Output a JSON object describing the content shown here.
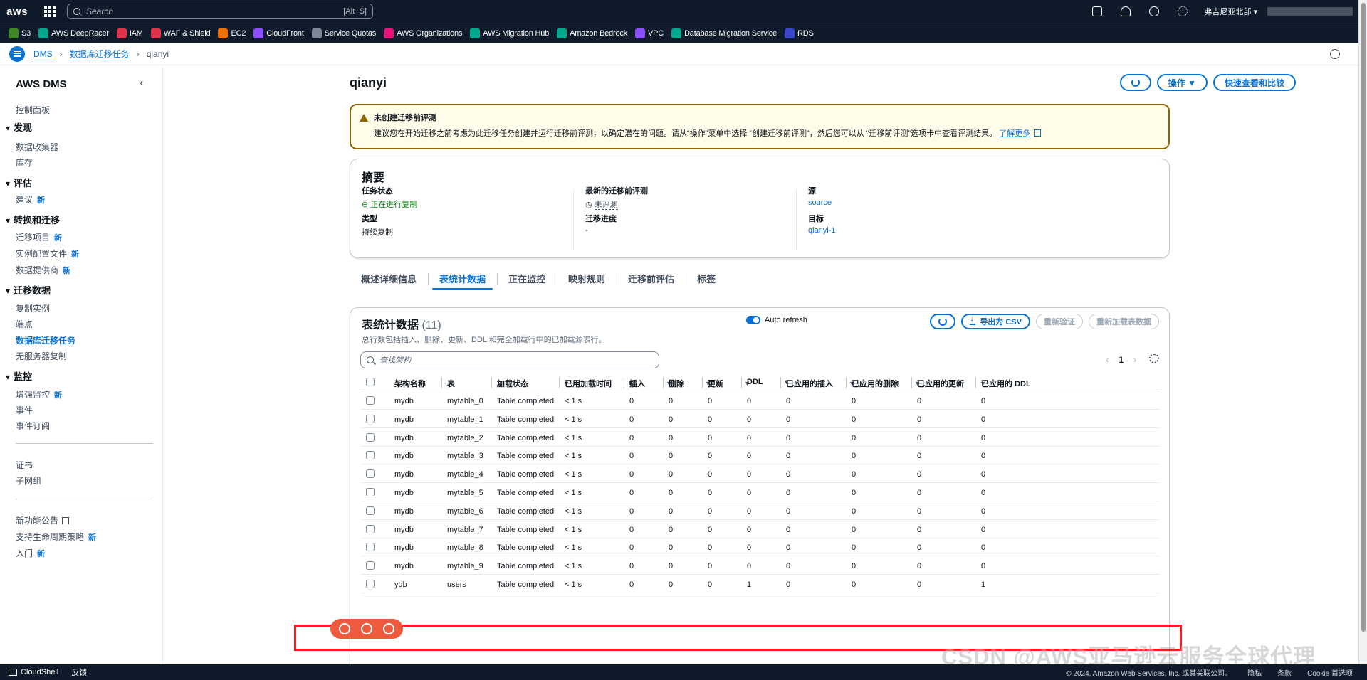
{
  "topnav": {
    "logo": "aws",
    "search_placeholder": "Search",
    "search_shortcut": "[Alt+S]",
    "region": "弗吉尼亚北部 ▾"
  },
  "favorites": [
    {
      "label": "S3",
      "color": "#3f8624"
    },
    {
      "label": "AWS DeepRacer",
      "color": "#01a88d"
    },
    {
      "label": "IAM",
      "color": "#dd344c"
    },
    {
      "label": "WAF & Shield",
      "color": "#dd344c"
    },
    {
      "label": "EC2",
      "color": "#ed7100"
    },
    {
      "label": "CloudFront",
      "color": "#8c4fff"
    },
    {
      "label": "Service Quotas",
      "color": "#7d8998"
    },
    {
      "label": "AWS Organizations",
      "color": "#e7157b"
    },
    {
      "label": "AWS Migration Hub",
      "color": "#01a88d"
    },
    {
      "label": "Amazon Bedrock",
      "color": "#01a88d"
    },
    {
      "label": "VPC",
      "color": "#8c4fff"
    },
    {
      "label": "Database Migration Service",
      "color": "#01a88d"
    },
    {
      "label": "RDS",
      "color": "#3b48cc"
    }
  ],
  "breadcrumb": {
    "root": "DMS",
    "parent": "数据库迁移任务",
    "current": "qianyi"
  },
  "sidebar": {
    "title": "AWS DMS",
    "dashboard": "控制面板",
    "sec_discover": "发现",
    "data_collectors": "数据收集器",
    "inventory": "库存",
    "sec_assess": "评估",
    "recommendations": "建议",
    "sec_convert": "转换和迁移",
    "migration_projects": "迁移项目",
    "instance_profiles": "实例配置文件",
    "data_providers": "数据提供商",
    "sec_migrate": "迁移数据",
    "replication_instances": "复制实例",
    "endpoints": "端点",
    "db_migration_tasks": "数据库迁移任务",
    "serverless": "无服务器复制",
    "sec_monitor": "监控",
    "enhanced_monitoring": "增强监控",
    "events": "事件",
    "event_subscriptions": "事件订阅",
    "certificates": "证书",
    "subnet_groups": "子网组",
    "whats_new": "新功能公告",
    "lifecycle": "支持生命周期策略",
    "getting_started": "入门",
    "new_badge": "新"
  },
  "page": {
    "title": "qianyi",
    "actions_label": "操作 ▼",
    "compare_label": "快速查看和比较"
  },
  "alert": {
    "title": "未创建迁移前评测",
    "body": "建议您在开始迁移之前考虑为此迁移任务创建并运行迁移前评测，以确定潜在的问题。请从“操作”菜单中选择 “创建迁移前评测”，然后您可以从 “迁移前评测”选项卡中查看评测结果。",
    "link": "了解更多"
  },
  "summary": {
    "heading": "摘要",
    "status_label": "任务状态",
    "status_value": "正在进行复制",
    "type_label": "类型",
    "type_value": "持续复制",
    "latest_assessment_label": "最新的迁移前评测",
    "latest_assessment_value": "未评测",
    "progress_label": "迁移进度",
    "progress_value": "-",
    "source_label": "源",
    "source_value": "source",
    "target_label": "目标",
    "target_value": "qianyi-1"
  },
  "tabs": [
    "概述详细信息",
    "表统计数据",
    "正在监控",
    "映射规则",
    "迁移前评估",
    "标签"
  ],
  "table_stats": {
    "title": "表统计数据",
    "count": "(11)",
    "description": "总行数包括插入、删除、更新、DDL 和完全加载行中的已加载源表行。",
    "auto_refresh": "Auto refresh",
    "export_csv": "导出为 CSV",
    "revalidate": "重新验证",
    "reload": "重新加载表数据",
    "filter_placeholder": "查找架构",
    "page": "1",
    "columns": [
      "架构名称",
      "表",
      "加载状态",
      "已用加载时间",
      "插入",
      "删除",
      "更新",
      "DDL",
      "已应用的插入",
      "已应用的删除",
      "已应用的更新",
      "已应用的 DDL"
    ],
    "rows": [
      [
        "mydb",
        "mytable_0",
        "Table completed",
        "< 1 s",
        "0",
        "0",
        "0",
        "0",
        "0",
        "0",
        "0",
        "0"
      ],
      [
        "mydb",
        "mytable_1",
        "Table completed",
        "< 1 s",
        "0",
        "0",
        "0",
        "0",
        "0",
        "0",
        "0",
        "0"
      ],
      [
        "mydb",
        "mytable_2",
        "Table completed",
        "< 1 s",
        "0",
        "0",
        "0",
        "0",
        "0",
        "0",
        "0",
        "0"
      ],
      [
        "mydb",
        "mytable_3",
        "Table completed",
        "< 1 s",
        "0",
        "0",
        "0",
        "0",
        "0",
        "0",
        "0",
        "0"
      ],
      [
        "mydb",
        "mytable_4",
        "Table completed",
        "< 1 s",
        "0",
        "0",
        "0",
        "0",
        "0",
        "0",
        "0",
        "0"
      ],
      [
        "mydb",
        "mytable_5",
        "Table completed",
        "< 1 s",
        "0",
        "0",
        "0",
        "0",
        "0",
        "0",
        "0",
        "0"
      ],
      [
        "mydb",
        "mytable_6",
        "Table completed",
        "< 1 s",
        "0",
        "0",
        "0",
        "0",
        "0",
        "0",
        "0",
        "0"
      ],
      [
        "mydb",
        "mytable_7",
        "Table completed",
        "< 1 s",
        "0",
        "0",
        "0",
        "0",
        "0",
        "0",
        "0",
        "0"
      ],
      [
        "mydb",
        "mytable_8",
        "Table completed",
        "< 1 s",
        "0",
        "0",
        "0",
        "0",
        "0",
        "0",
        "0",
        "0"
      ],
      [
        "mydb",
        "mytable_9",
        "Table completed",
        "< 1 s",
        "0",
        "0",
        "0",
        "0",
        "0",
        "0",
        "0",
        "0"
      ],
      [
        "ydb",
        "users",
        "Table completed",
        "< 1 s",
        "0",
        "0",
        "0",
        "1",
        "0",
        "0",
        "0",
        "1"
      ]
    ]
  },
  "watermark": "CSDN @AWS亚马逊云服务全球代理",
  "footer": {
    "cloudshell": "CloudShell",
    "feedback": "反馈",
    "copyright": "© 2024, Amazon Web Services, Inc. 或其关联公司。",
    "privacy": "隐私",
    "terms": "条款",
    "cookie": "Cookie 首选项"
  }
}
